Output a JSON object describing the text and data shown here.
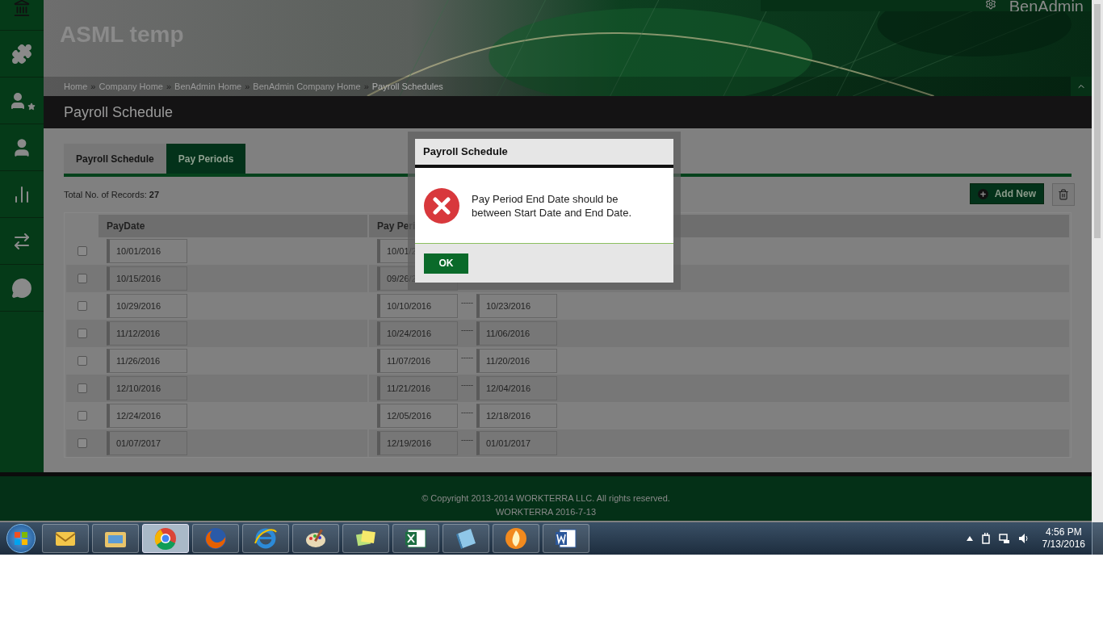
{
  "header": {
    "site_title": "ASML temp",
    "user": "BenAdmin"
  },
  "breadcrumb": [
    "Home",
    "Company Home",
    "BenAdmin Home",
    "BenAdmin Company Home",
    "Payroll Schedules"
  ],
  "breadcrumb_separator": "»",
  "page_title": "Payroll Schedule",
  "tabs": [
    {
      "label": "Payroll Schedule",
      "selected": false
    },
    {
      "label": "Pay Periods",
      "selected": true
    }
  ],
  "records": {
    "label": "Total No. of Records:",
    "count": "27"
  },
  "add_button": "Add New",
  "table": {
    "columns": [
      "PayDate",
      "Pay Peri"
    ],
    "rows": [
      {
        "checked": false,
        "pay_date": "10/01/2016",
        "period_start": "10/01/2"
      },
      {
        "checked": false,
        "pay_date": "10/15/2016",
        "period_start": "09/26/2"
      },
      {
        "checked": false,
        "pay_date": "10/29/2016",
        "period_start": "10/10/2016",
        "separator": "-----",
        "period_end": "10/23/2016"
      },
      {
        "checked": false,
        "pay_date": "11/12/2016",
        "period_start": "10/24/2016",
        "separator": "-----",
        "period_end": "11/06/2016"
      },
      {
        "checked": false,
        "pay_date": "11/26/2016",
        "period_start": "11/07/2016",
        "separator": "-----",
        "period_end": "11/20/2016"
      },
      {
        "checked": false,
        "pay_date": "12/10/2016",
        "period_start": "11/21/2016",
        "separator": "-----",
        "period_end": "12/04/2016"
      },
      {
        "checked": false,
        "pay_date": "12/24/2016",
        "period_start": "12/05/2016",
        "separator": "-----",
        "period_end": "12/18/2016"
      },
      {
        "checked": false,
        "pay_date": "01/07/2017",
        "period_start": "12/19/2016",
        "separator": "-----",
        "period_end": "01/01/2017"
      }
    ]
  },
  "dialog": {
    "title": "Payroll Schedule",
    "message": "Pay Period End Date should be between Start Date and End Date.",
    "button": "OK"
  },
  "footer": {
    "copyright": "© Copyright 2013-2014 WORKTERRA LLC. All rights reserved.",
    "version": "WORKTERRA 2016-7-13"
  },
  "taskbar": {
    "apps": [
      {
        "kind": "mail",
        "selected": false
      },
      {
        "kind": "folder",
        "selected": false
      },
      {
        "kind": "chrome",
        "selected": true
      },
      {
        "kind": "firefox",
        "selected": false
      },
      {
        "kind": "ie",
        "selected": false
      },
      {
        "kind": "paint",
        "selected": false
      },
      {
        "kind": "notes",
        "selected": false
      },
      {
        "kind": "excel",
        "selected": false
      },
      {
        "kind": "book",
        "selected": false
      },
      {
        "kind": "flame",
        "selected": false
      },
      {
        "kind": "word",
        "selected": false
      }
    ],
    "time": "4:56 PM",
    "date": "7/13/2016"
  }
}
